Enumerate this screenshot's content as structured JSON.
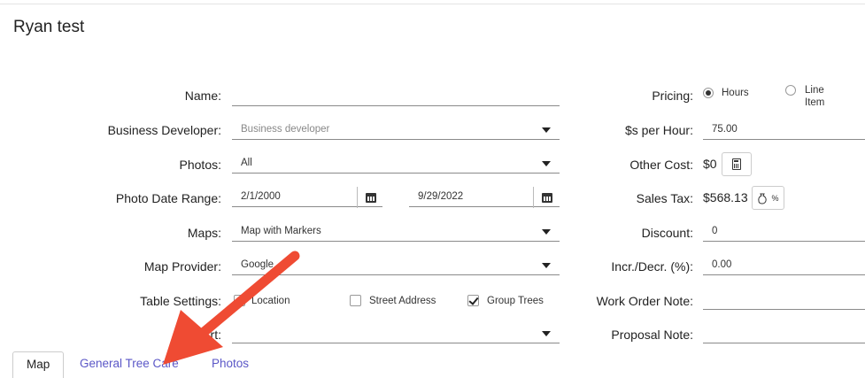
{
  "page": {
    "title": "Ryan test"
  },
  "left_form": {
    "name": {
      "label": "Name:",
      "value": ""
    },
    "business_developer": {
      "label": "Business Developer:",
      "placeholder": "Business developer"
    },
    "photos": {
      "label": "Photos:",
      "value": "All"
    },
    "photo_date_range": {
      "label": "Photo Date Range:",
      "start": "2/1/2000",
      "end": "9/29/2022"
    },
    "maps": {
      "label": "Maps:",
      "value": "Map with Markers"
    },
    "map_provider": {
      "label": "Map Provider:",
      "value": "Google"
    },
    "table_settings": {
      "label": "Table Settings:",
      "options": [
        {
          "label": "Location",
          "checked": false
        },
        {
          "label": "Street Address",
          "checked": false
        },
        {
          "label": "Group Trees",
          "checked": true
        }
      ]
    },
    "sort": {
      "label_visible": "rt:",
      "value": ""
    }
  },
  "right_form": {
    "pricing": {
      "label": "Pricing:",
      "option_hours": "Hours",
      "option_line_item_1": "Line",
      "option_line_item_2": "Item",
      "selected": "Hours"
    },
    "dollars_per_hour": {
      "label": "$s per Hour:",
      "value": "75.00"
    },
    "other_cost": {
      "label": "Other Cost:",
      "value": "$0",
      "icon": "calculator-icon"
    },
    "sales_tax": {
      "label": "Sales Tax:",
      "value": "$568.13",
      "icon": "money-bag-percent-icon",
      "icon_text": "%"
    },
    "discount": {
      "label": "Discount:",
      "value": "0"
    },
    "incr_decr": {
      "label": "Incr./Decr. (%):",
      "value": "0.00"
    },
    "work_order_note": {
      "label": "Work Order Note:",
      "value": ""
    },
    "proposal_note": {
      "label": "Proposal Note:",
      "value": ""
    }
  },
  "tabs": [
    {
      "label": "Map",
      "active": true
    },
    {
      "label": "General Tree Care",
      "active": false
    },
    {
      "label": "Photos",
      "active": false
    }
  ],
  "annotation": {
    "arrow_color": "#ef4b33"
  }
}
